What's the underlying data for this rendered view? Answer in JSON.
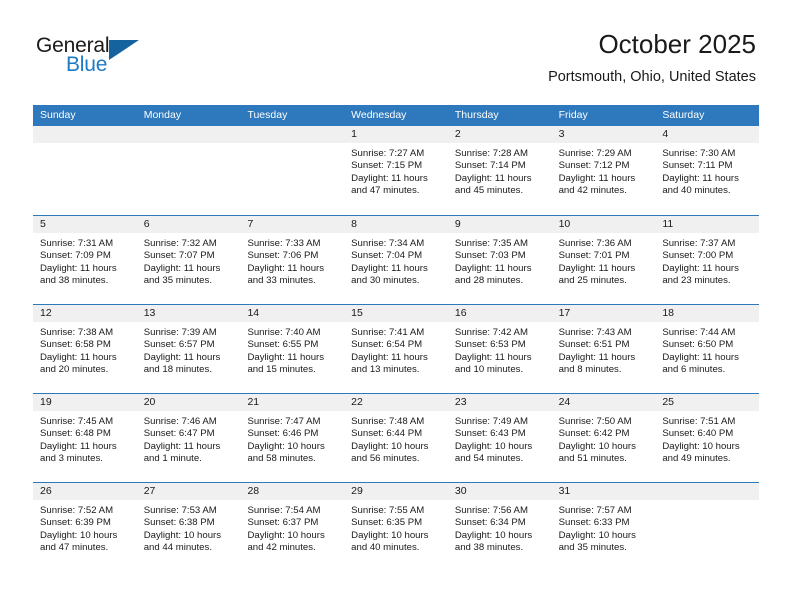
{
  "brand": {
    "name_part1": "General",
    "name_part2": "Blue",
    "accent_color": "#1f7ac4",
    "triangle_color": "#15639e"
  },
  "header": {
    "title": "October 2025",
    "location": "Portsmouth, Ohio, United States"
  },
  "weekday_headers": [
    "Sunday",
    "Monday",
    "Tuesday",
    "Wednesday",
    "Thursday",
    "Friday",
    "Saturday"
  ],
  "theme": {
    "header_bar_color": "#2e78bd",
    "date_band_color": "#f0f0f0",
    "text_color": "#1a1a1a"
  },
  "weeks": [
    [
      {
        "day": "",
        "sunrise": "",
        "sunset": "",
        "daylight_1": "",
        "daylight_2": ""
      },
      {
        "day": "",
        "sunrise": "",
        "sunset": "",
        "daylight_1": "",
        "daylight_2": ""
      },
      {
        "day": "",
        "sunrise": "",
        "sunset": "",
        "daylight_1": "",
        "daylight_2": ""
      },
      {
        "day": "1",
        "sunrise": "Sunrise: 7:27 AM",
        "sunset": "Sunset: 7:15 PM",
        "daylight_1": "Daylight: 11 hours",
        "daylight_2": "and 47 minutes."
      },
      {
        "day": "2",
        "sunrise": "Sunrise: 7:28 AM",
        "sunset": "Sunset: 7:14 PM",
        "daylight_1": "Daylight: 11 hours",
        "daylight_2": "and 45 minutes."
      },
      {
        "day": "3",
        "sunrise": "Sunrise: 7:29 AM",
        "sunset": "Sunset: 7:12 PM",
        "daylight_1": "Daylight: 11 hours",
        "daylight_2": "and 42 minutes."
      },
      {
        "day": "4",
        "sunrise": "Sunrise: 7:30 AM",
        "sunset": "Sunset: 7:11 PM",
        "daylight_1": "Daylight: 11 hours",
        "daylight_2": "and 40 minutes."
      }
    ],
    [
      {
        "day": "5",
        "sunrise": "Sunrise: 7:31 AM",
        "sunset": "Sunset: 7:09 PM",
        "daylight_1": "Daylight: 11 hours",
        "daylight_2": "and 38 minutes."
      },
      {
        "day": "6",
        "sunrise": "Sunrise: 7:32 AM",
        "sunset": "Sunset: 7:07 PM",
        "daylight_1": "Daylight: 11 hours",
        "daylight_2": "and 35 minutes."
      },
      {
        "day": "7",
        "sunrise": "Sunrise: 7:33 AM",
        "sunset": "Sunset: 7:06 PM",
        "daylight_1": "Daylight: 11 hours",
        "daylight_2": "and 33 minutes."
      },
      {
        "day": "8",
        "sunrise": "Sunrise: 7:34 AM",
        "sunset": "Sunset: 7:04 PM",
        "daylight_1": "Daylight: 11 hours",
        "daylight_2": "and 30 minutes."
      },
      {
        "day": "9",
        "sunrise": "Sunrise: 7:35 AM",
        "sunset": "Sunset: 7:03 PM",
        "daylight_1": "Daylight: 11 hours",
        "daylight_2": "and 28 minutes."
      },
      {
        "day": "10",
        "sunrise": "Sunrise: 7:36 AM",
        "sunset": "Sunset: 7:01 PM",
        "daylight_1": "Daylight: 11 hours",
        "daylight_2": "and 25 minutes."
      },
      {
        "day": "11",
        "sunrise": "Sunrise: 7:37 AM",
        "sunset": "Sunset: 7:00 PM",
        "daylight_1": "Daylight: 11 hours",
        "daylight_2": "and 23 minutes."
      }
    ],
    [
      {
        "day": "12",
        "sunrise": "Sunrise: 7:38 AM",
        "sunset": "Sunset: 6:58 PM",
        "daylight_1": "Daylight: 11 hours",
        "daylight_2": "and 20 minutes."
      },
      {
        "day": "13",
        "sunrise": "Sunrise: 7:39 AM",
        "sunset": "Sunset: 6:57 PM",
        "daylight_1": "Daylight: 11 hours",
        "daylight_2": "and 18 minutes."
      },
      {
        "day": "14",
        "sunrise": "Sunrise: 7:40 AM",
        "sunset": "Sunset: 6:55 PM",
        "daylight_1": "Daylight: 11 hours",
        "daylight_2": "and 15 minutes."
      },
      {
        "day": "15",
        "sunrise": "Sunrise: 7:41 AM",
        "sunset": "Sunset: 6:54 PM",
        "daylight_1": "Daylight: 11 hours",
        "daylight_2": "and 13 minutes."
      },
      {
        "day": "16",
        "sunrise": "Sunrise: 7:42 AM",
        "sunset": "Sunset: 6:53 PM",
        "daylight_1": "Daylight: 11 hours",
        "daylight_2": "and 10 minutes."
      },
      {
        "day": "17",
        "sunrise": "Sunrise: 7:43 AM",
        "sunset": "Sunset: 6:51 PM",
        "daylight_1": "Daylight: 11 hours",
        "daylight_2": "and 8 minutes."
      },
      {
        "day": "18",
        "sunrise": "Sunrise: 7:44 AM",
        "sunset": "Sunset: 6:50 PM",
        "daylight_1": "Daylight: 11 hours",
        "daylight_2": "and 6 minutes."
      }
    ],
    [
      {
        "day": "19",
        "sunrise": "Sunrise: 7:45 AM",
        "sunset": "Sunset: 6:48 PM",
        "daylight_1": "Daylight: 11 hours",
        "daylight_2": "and 3 minutes."
      },
      {
        "day": "20",
        "sunrise": "Sunrise: 7:46 AM",
        "sunset": "Sunset: 6:47 PM",
        "daylight_1": "Daylight: 11 hours",
        "daylight_2": "and 1 minute."
      },
      {
        "day": "21",
        "sunrise": "Sunrise: 7:47 AM",
        "sunset": "Sunset: 6:46 PM",
        "daylight_1": "Daylight: 10 hours",
        "daylight_2": "and 58 minutes."
      },
      {
        "day": "22",
        "sunrise": "Sunrise: 7:48 AM",
        "sunset": "Sunset: 6:44 PM",
        "daylight_1": "Daylight: 10 hours",
        "daylight_2": "and 56 minutes."
      },
      {
        "day": "23",
        "sunrise": "Sunrise: 7:49 AM",
        "sunset": "Sunset: 6:43 PM",
        "daylight_1": "Daylight: 10 hours",
        "daylight_2": "and 54 minutes."
      },
      {
        "day": "24",
        "sunrise": "Sunrise: 7:50 AM",
        "sunset": "Sunset: 6:42 PM",
        "daylight_1": "Daylight: 10 hours",
        "daylight_2": "and 51 minutes."
      },
      {
        "day": "25",
        "sunrise": "Sunrise: 7:51 AM",
        "sunset": "Sunset: 6:40 PM",
        "daylight_1": "Daylight: 10 hours",
        "daylight_2": "and 49 minutes."
      }
    ],
    [
      {
        "day": "26",
        "sunrise": "Sunrise: 7:52 AM",
        "sunset": "Sunset: 6:39 PM",
        "daylight_1": "Daylight: 10 hours",
        "daylight_2": "and 47 minutes."
      },
      {
        "day": "27",
        "sunrise": "Sunrise: 7:53 AM",
        "sunset": "Sunset: 6:38 PM",
        "daylight_1": "Daylight: 10 hours",
        "daylight_2": "and 44 minutes."
      },
      {
        "day": "28",
        "sunrise": "Sunrise: 7:54 AM",
        "sunset": "Sunset: 6:37 PM",
        "daylight_1": "Daylight: 10 hours",
        "daylight_2": "and 42 minutes."
      },
      {
        "day": "29",
        "sunrise": "Sunrise: 7:55 AM",
        "sunset": "Sunset: 6:35 PM",
        "daylight_1": "Daylight: 10 hours",
        "daylight_2": "and 40 minutes."
      },
      {
        "day": "30",
        "sunrise": "Sunrise: 7:56 AM",
        "sunset": "Sunset: 6:34 PM",
        "daylight_1": "Daylight: 10 hours",
        "daylight_2": "and 38 minutes."
      },
      {
        "day": "31",
        "sunrise": "Sunrise: 7:57 AM",
        "sunset": "Sunset: 6:33 PM",
        "daylight_1": "Daylight: 10 hours",
        "daylight_2": "and 35 minutes."
      },
      {
        "day": "",
        "sunrise": "",
        "sunset": "",
        "daylight_1": "",
        "daylight_2": ""
      }
    ]
  ]
}
